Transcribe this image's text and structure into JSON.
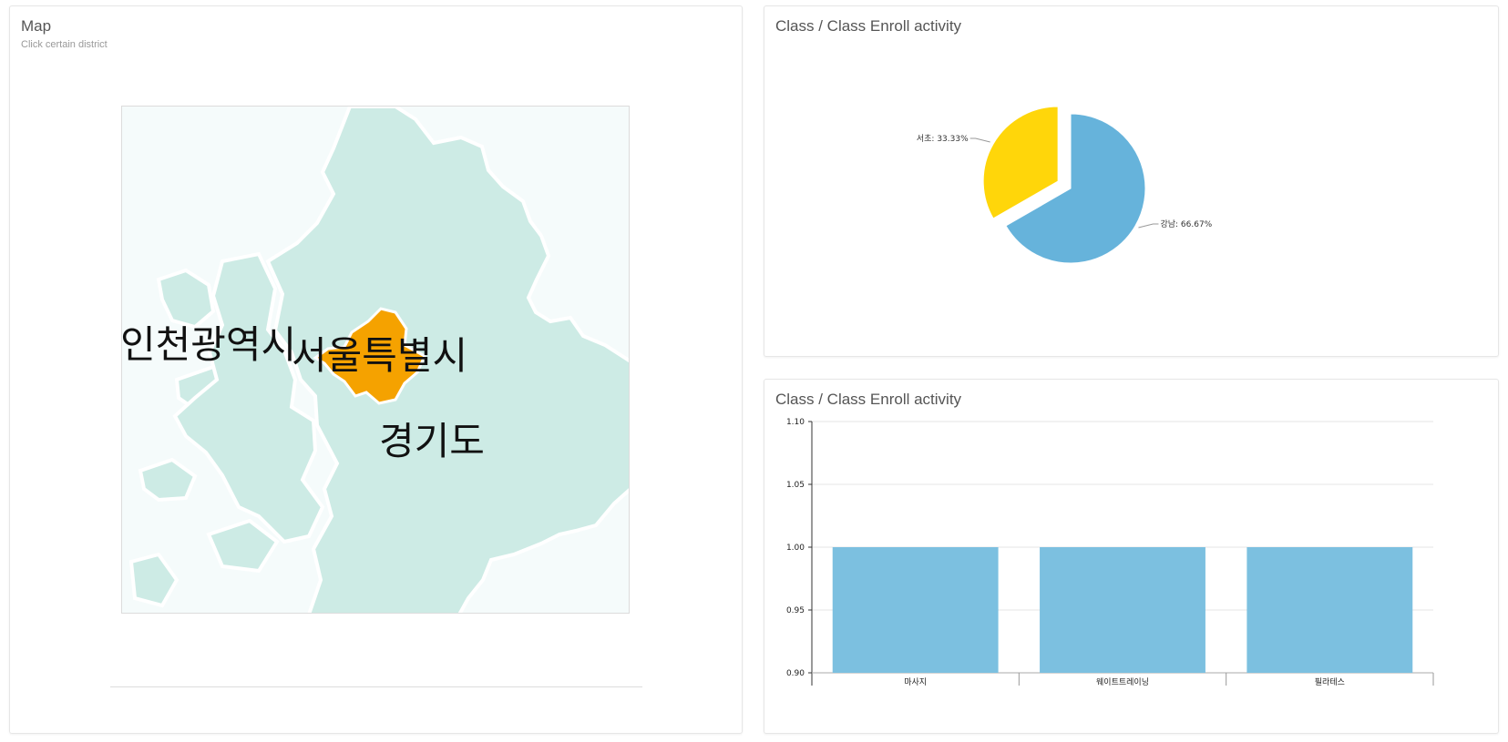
{
  "map_panel": {
    "title": "Map",
    "subtitle": "Click certain district",
    "regions": [
      {
        "name": "인천광역시",
        "fill": "#cdebe5",
        "selected": false
      },
      {
        "name": "서울특별시",
        "fill": "#f5a200",
        "selected": true
      },
      {
        "name": "경기도",
        "fill": "#cdebe5",
        "selected": false
      }
    ]
  },
  "pie_panel": {
    "title": "Class / Class Enroll activity",
    "chart_data": {
      "type": "pie",
      "slices": [
        {
          "label": "강남",
          "value": 66.67,
          "display": "강남: 66.67%",
          "color": "#66b3db"
        },
        {
          "label": "서초",
          "value": 33.33,
          "display": "서초: 33.33%",
          "color": "#ffd60a"
        }
      ]
    }
  },
  "bar_panel": {
    "title": "Class / Class Enroll activity",
    "chart_data": {
      "type": "bar",
      "categories": [
        "마사지",
        "웨이트트레이닝",
        "필라테스"
      ],
      "values": [
        1.0,
        1.0,
        1.0
      ],
      "ylim": [
        0.9,
        1.1
      ],
      "yticks": [
        "0.90",
        "0.95",
        "1.00",
        "1.05",
        "1.10"
      ],
      "color": "#7cc0e0",
      "grid": true
    }
  }
}
